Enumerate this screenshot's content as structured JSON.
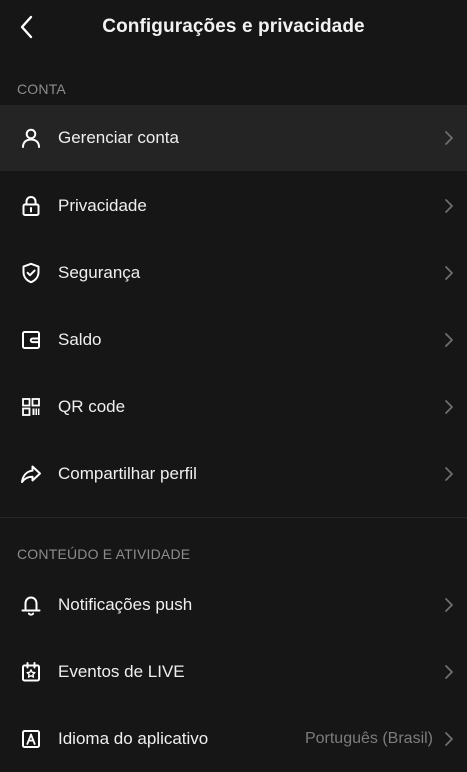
{
  "header": {
    "title": "Configurações e privacidade"
  },
  "sections": {
    "conta": {
      "label": "CONTA",
      "items": [
        {
          "label": "Gerenciar conta",
          "icon": "person-icon"
        },
        {
          "label": "Privacidade",
          "icon": "lock-icon"
        },
        {
          "label": "Segurança",
          "icon": "shield-check-icon"
        },
        {
          "label": "Saldo",
          "icon": "wallet-icon"
        },
        {
          "label": "QR code",
          "icon": "qr-code-icon"
        },
        {
          "label": "Compartilhar perfil",
          "icon": "share-arrow-icon"
        }
      ]
    },
    "conteudo": {
      "label": "CONTEÚDO E ATIVIDADE",
      "items": [
        {
          "label": "Notificações push",
          "icon": "bell-icon"
        },
        {
          "label": "Eventos de LIVE",
          "icon": "calendar-star-icon"
        },
        {
          "label": "Idioma do aplicativo",
          "icon": "letter-a-icon",
          "value": "Português (Brasil)"
        }
      ]
    }
  },
  "colors": {
    "background": "#161616",
    "highlight_row": "#242424",
    "section_label": "#8c8c8c",
    "chevron": "#6e6e6e"
  }
}
